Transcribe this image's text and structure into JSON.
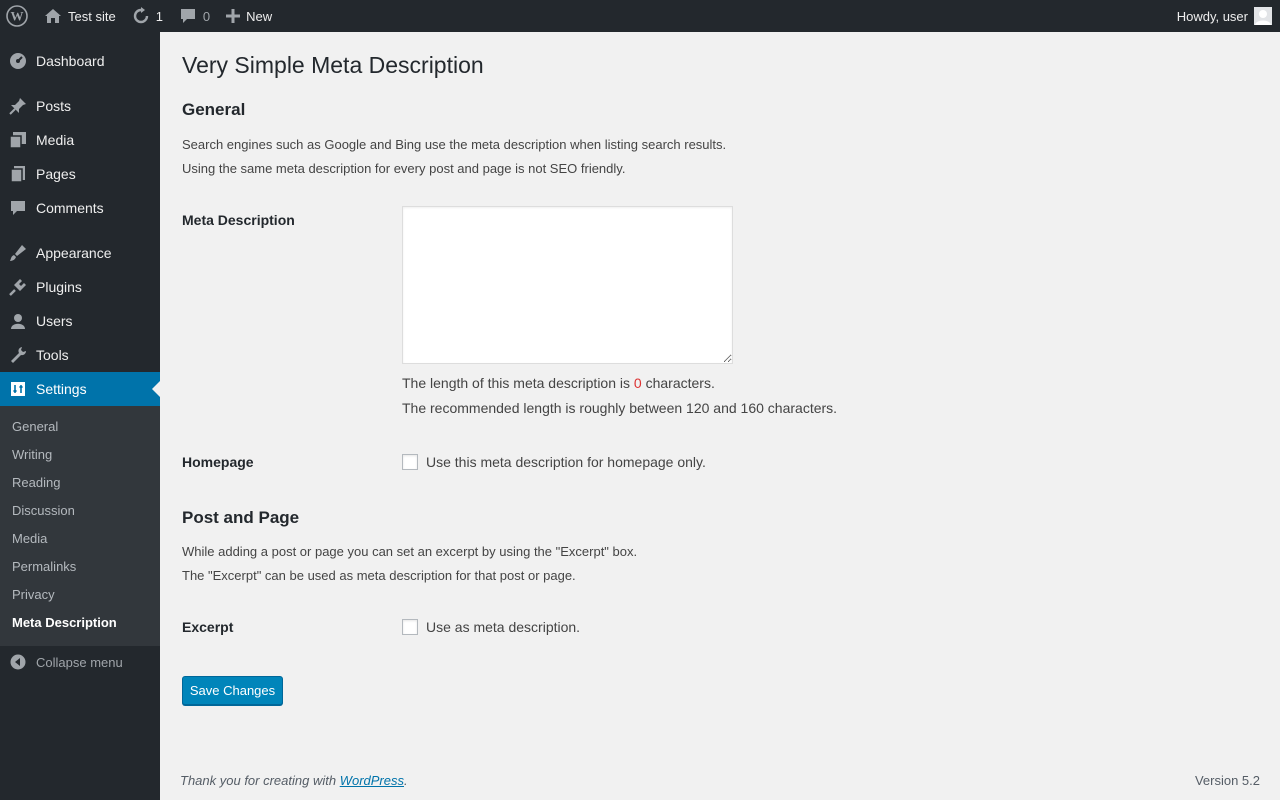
{
  "adminbar": {
    "site_name": "Test site",
    "updates_count": "1",
    "comments_count": "0",
    "new_label": "New",
    "howdy": "Howdy, user"
  },
  "sidebar": {
    "items": [
      {
        "label": "Dashboard",
        "icon": "dashboard-icon"
      },
      {
        "label": "Posts",
        "icon": "pin-icon"
      },
      {
        "label": "Media",
        "icon": "media-icon"
      },
      {
        "label": "Pages",
        "icon": "pages-icon"
      },
      {
        "label": "Comments",
        "icon": "comment-icon"
      },
      {
        "label": "Appearance",
        "icon": "brush-icon"
      },
      {
        "label": "Plugins",
        "icon": "plugin-icon"
      },
      {
        "label": "Users",
        "icon": "user-icon"
      },
      {
        "label": "Tools",
        "icon": "wrench-icon"
      },
      {
        "label": "Settings",
        "icon": "settings-icon"
      }
    ],
    "submenu": [
      "General",
      "Writing",
      "Reading",
      "Discussion",
      "Media",
      "Permalinks",
      "Privacy",
      "Meta Description"
    ],
    "collapse": "Collapse menu"
  },
  "main": {
    "title": "Very Simple Meta Description",
    "general": {
      "heading": "General",
      "line1": "Search engines such as Google and Bing use the meta description when listing search results.",
      "line2": "Using the same meta description for every post and page is not SEO friendly."
    },
    "meta": {
      "label": "Meta Description",
      "value": "",
      "length_prefix": "The length of this meta description is ",
      "length_count": "0",
      "length_suffix": " characters.",
      "recommended": "The recommended length is roughly between 120 and 160 characters."
    },
    "homepage": {
      "label": "Homepage",
      "checkbox_label": "Use this meta description for homepage only.",
      "checked": false
    },
    "post_page": {
      "heading": "Post and Page",
      "line1": "While adding a post or page you can set an excerpt by using the \"Excerpt\" box.",
      "line2": "The \"Excerpt\" can be used as meta description for that post or page."
    },
    "excerpt": {
      "label": "Excerpt",
      "checkbox_label": "Use as meta description.",
      "checked": false
    },
    "save_label": "Save Changes"
  },
  "footer": {
    "thanks_prefix": "Thank you for creating with ",
    "thanks_link": "WordPress",
    "thanks_suffix": ".",
    "version": "Version 5.2"
  },
  "colors": {
    "adminbar_bg": "#23282d",
    "active_menu": "#0073aa",
    "primary_button": "#0085ba",
    "count_red": "#dc3232"
  }
}
